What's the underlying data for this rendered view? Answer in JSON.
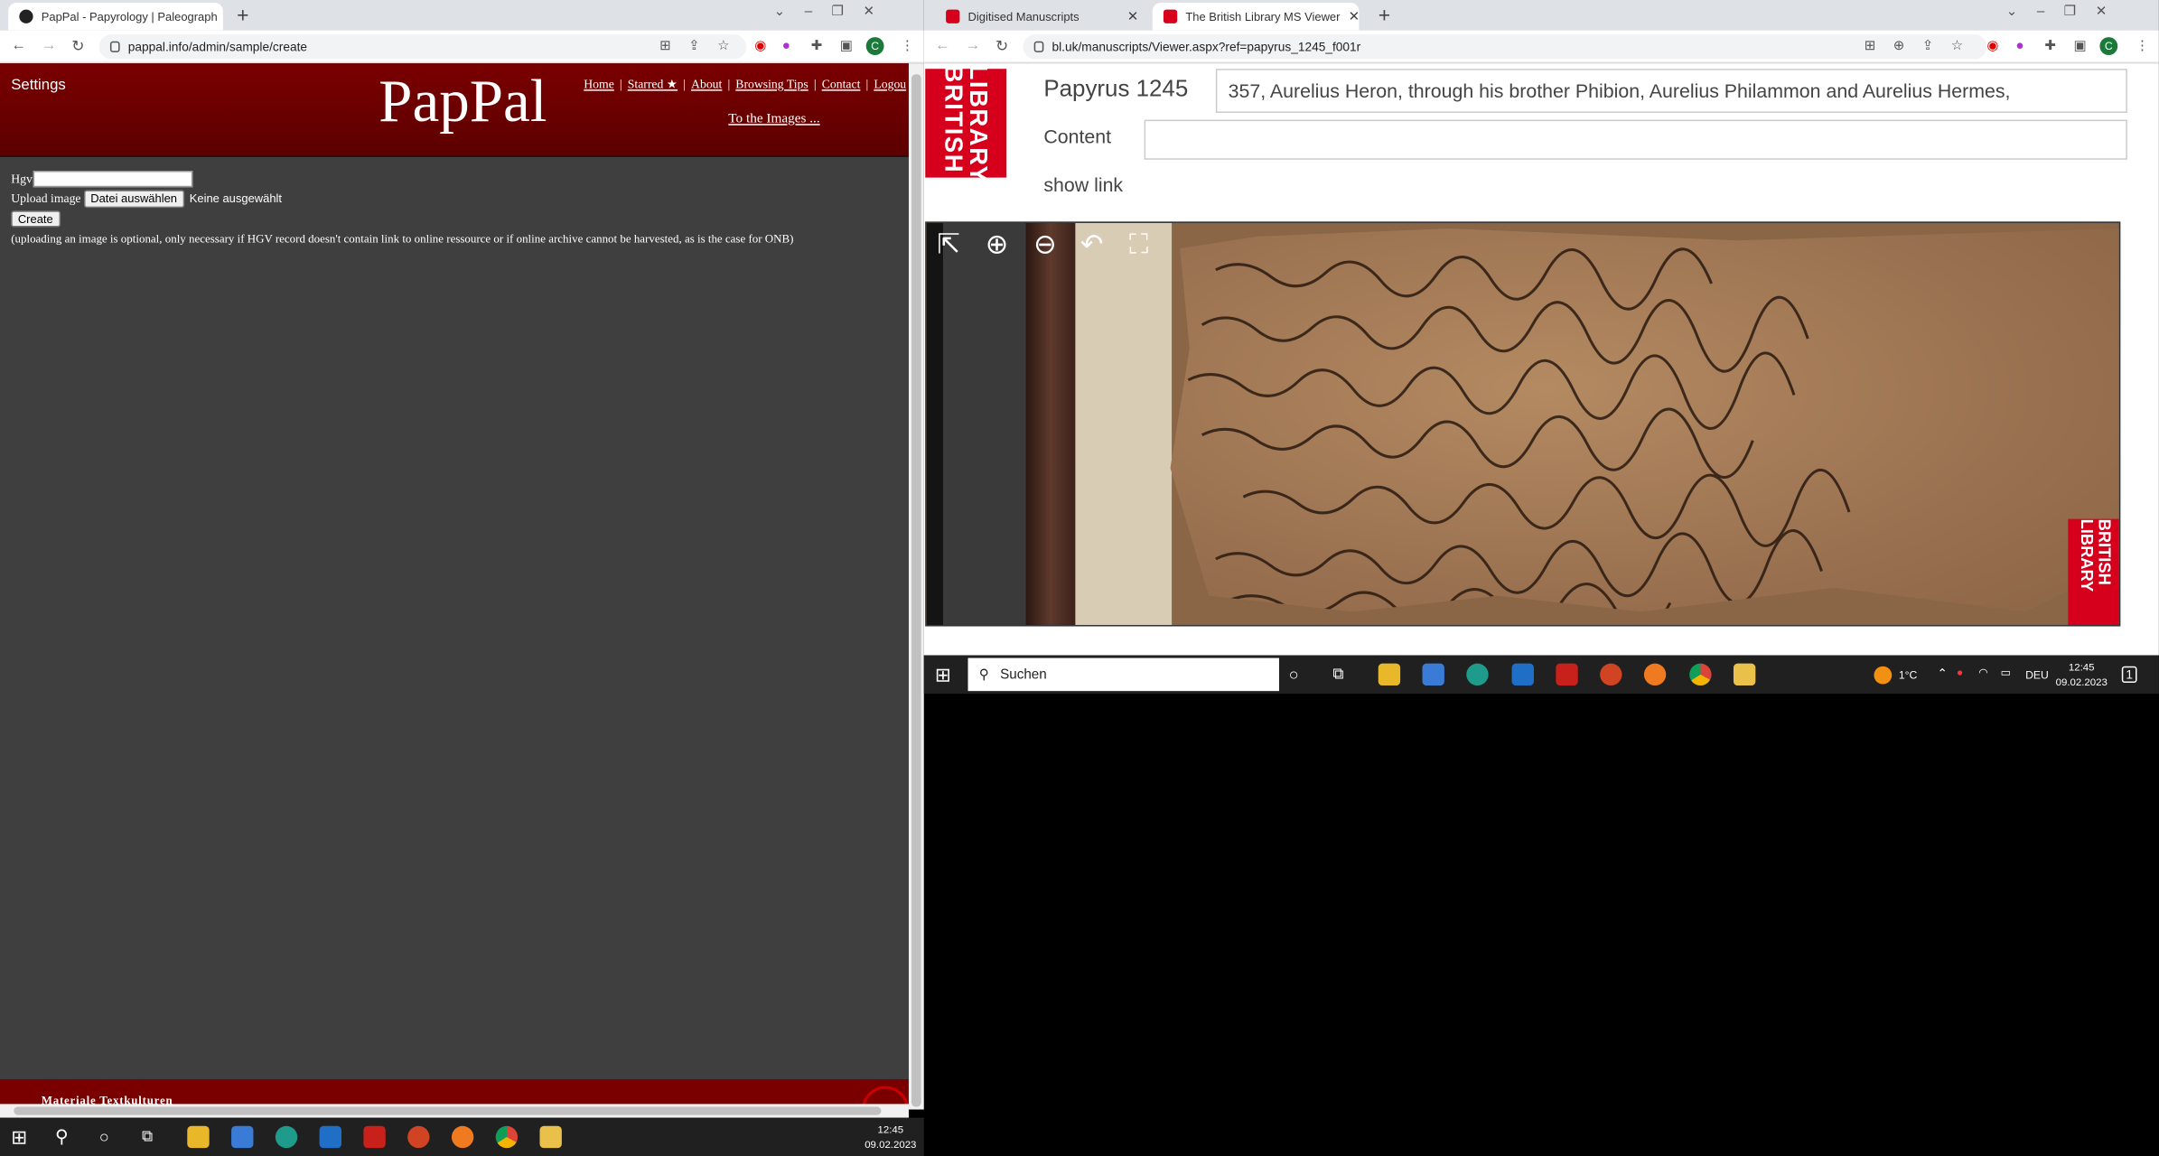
{
  "left_window": {
    "tab_title": "PapPal - Papyrology | Paleograph",
    "url": "pappal.info/admin/sample/create",
    "page": {
      "settings_label": "Settings",
      "logo": "PapPal",
      "nav": [
        "Home",
        "Starred ★",
        "About",
        "Browsing Tips",
        "Contact",
        "Logou"
      ],
      "images_link": "To the Images ...",
      "hgv_label": "Hgv",
      "upload_label": "Upload image",
      "file_button": "Datei auswählen",
      "no_file_text": "Keine ausgewählt",
      "create_button": "Create",
      "note": "(uploading an image is optional, only necessary if HGV record doesn't contain link to online ressource or if online archive cannot be harvested, as is the case for ONB)",
      "footer_text": "Materiale Textkulturen"
    },
    "taskbar": {
      "time": "12:45",
      "date": "09.02.2023"
    }
  },
  "right_window": {
    "tabs": [
      {
        "title": "Digitised Manuscripts",
        "active": false
      },
      {
        "title": "The British Library MS Viewer",
        "active": true
      }
    ],
    "url": "bl.uk/manuscripts/Viewer.aspx?ref=papyrus_1245_f001r",
    "page": {
      "logo_text": "LIBRARY BRITISH",
      "title": "Papyrus 1245",
      "description": "357, Aurelius Heron, through his brother Phibion, Aurelius Philammon and Aurelius Hermes,",
      "content_label": "Content",
      "content_value": "",
      "show_link": "show link",
      "badge_text": "BRITISH LIBRARY"
    },
    "taskbar": {
      "search_placeholder": "Suchen",
      "temperature": "1°C",
      "language": "DEU",
      "time": "12:45",
      "date": "09.02.2023",
      "notification_count": "1"
    }
  },
  "colors": {
    "pappal_red": "#7a0000",
    "bl_red": "#d6001c",
    "page_grey": "#3f3f3f"
  }
}
